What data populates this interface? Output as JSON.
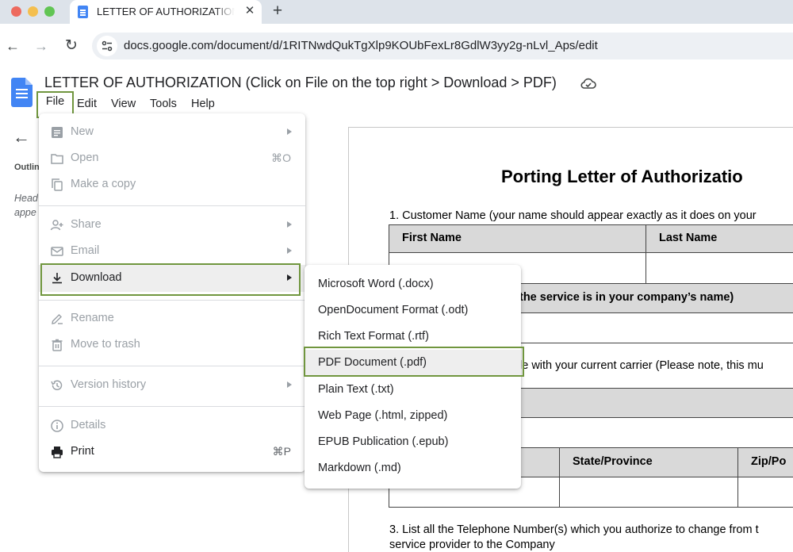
{
  "browser": {
    "tab_title": "LETTER OF AUTHORIZATION",
    "tab_close": "✕",
    "new_tab": "+",
    "url": "docs.google.com/document/d/1RITNwdQukTgXlp9KOUbFexLr8GdlW3yy2g-nLvl_Aps/edit",
    "back": "←",
    "forward": "→",
    "reload": "↻"
  },
  "docs": {
    "title": "LETTER OF AUTHORIZATION (Click on File on the top right > Download > PDF)",
    "menubar": [
      "File",
      "Edit",
      "View",
      "Tools",
      "Help"
    ]
  },
  "outline": {
    "back": "←",
    "title": "Outlin",
    "hint_1": "Head",
    "hint_2": "appe"
  },
  "file_menu": {
    "items": [
      {
        "label": "New",
        "icon": "new-doc-icon",
        "state": "disabled",
        "submenu": true
      },
      {
        "label": "Open",
        "icon": "folder-icon",
        "state": "disabled",
        "shortcut": "⌘O"
      },
      {
        "label": "Make a copy",
        "icon": "copy-icon",
        "state": "disabled"
      },
      {
        "label": "Share",
        "icon": "share-person-icon",
        "state": "disabled",
        "submenu": true
      },
      {
        "label": "Email",
        "icon": "email-icon",
        "state": "disabled",
        "submenu": true
      },
      {
        "label": "Download",
        "icon": "download-icon",
        "state": "enabled",
        "submenu": true,
        "highlighted": true
      },
      {
        "label": "Rename",
        "icon": "rename-icon",
        "state": "disabled"
      },
      {
        "label": "Move to trash",
        "icon": "trash-icon",
        "state": "disabled"
      },
      {
        "label": "Version history",
        "icon": "history-icon",
        "state": "disabled",
        "submenu": true
      },
      {
        "label": "Details",
        "icon": "info-icon",
        "state": "disabled"
      },
      {
        "label": "Print",
        "icon": "printer-icon",
        "state": "enabled",
        "shortcut": "⌘P"
      }
    ]
  },
  "download_menu": {
    "items": [
      "Microsoft Word (.docx)",
      "OpenDocument Format (.odt)",
      "Rich Text Format (.rtf)",
      "PDF Document (.pdf)",
      "Plain Text (.txt)",
      "Web Page (.html, zipped)",
      "EPUB Publication (.epub)",
      "Markdown (.md)"
    ],
    "highlighted": "PDF Document (.pdf)"
  },
  "document": {
    "heading": "Porting Letter of Authorizatio",
    "line_1": "1. Customer Name (your name should appear exactly as it does on your",
    "col_first_name": "First Name",
    "col_last_name": "Last Name",
    "company_fragment": "the service is in your company’s name)",
    "carrier_fragment": "le with your current carrier (Please note, this mu",
    "col_state": "State/Province",
    "col_zip": "Zip/Po",
    "line_3a": "3. List all the Telephone Number(s) which you authorize to change from t",
    "line_3b": "service provider to the Company"
  },
  "colors": {
    "highlight_frame": "#70963e",
    "tab_strip": "#dde3ea",
    "docs_blue": "#4285f4"
  }
}
